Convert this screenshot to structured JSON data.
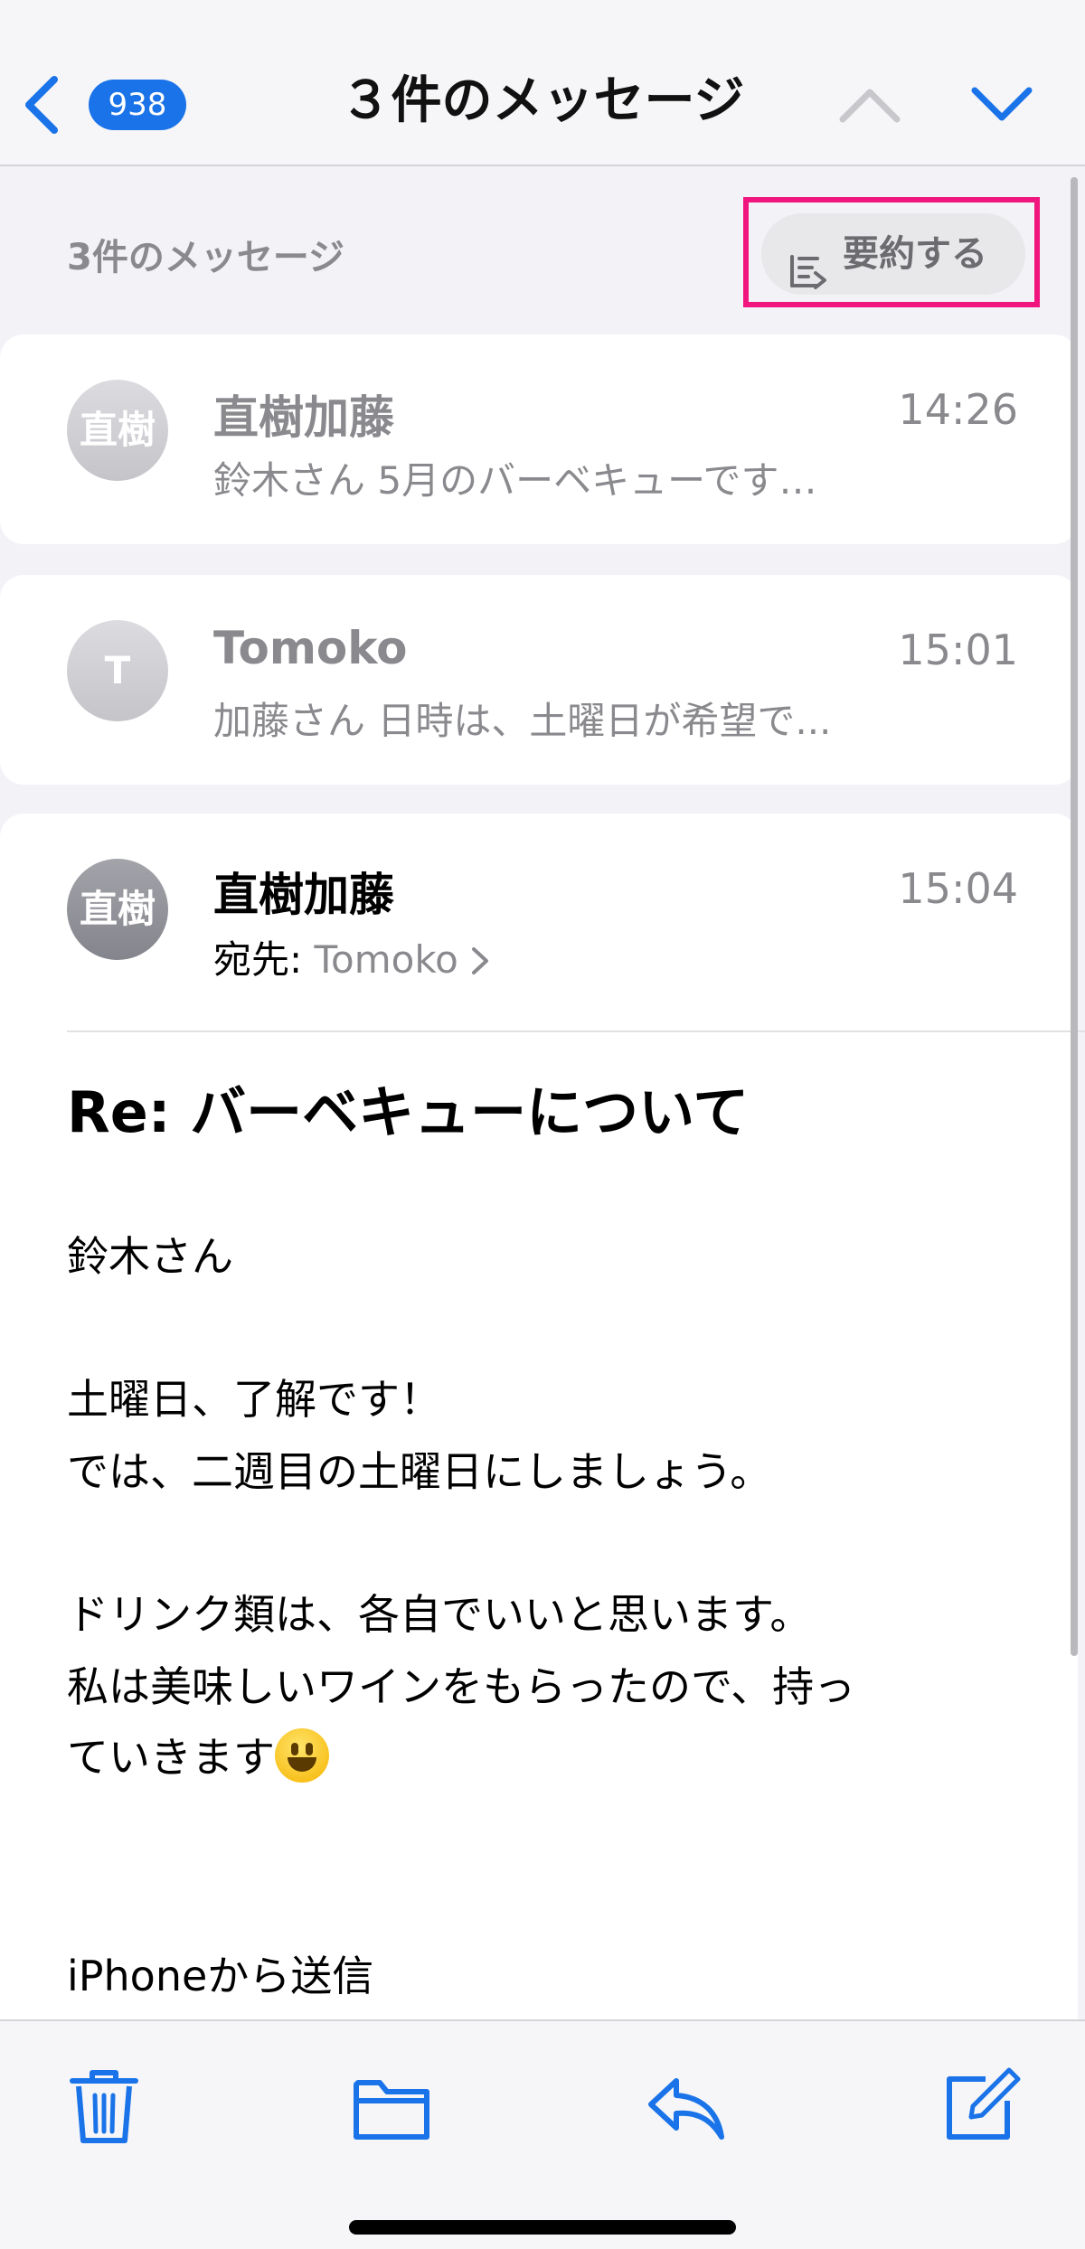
{
  "nav": {
    "unread_count": "938",
    "title": "３件のメッセージ"
  },
  "thread": {
    "count_label": "3件のメッセージ",
    "summarize_label": "要約する"
  },
  "messages": [
    {
      "avatar": "直樹",
      "sender": "直樹加藤",
      "time": "14:26",
      "preview": "鈴木さん 5月のバーベキューです…"
    },
    {
      "avatar": "T",
      "sender": "Tomoko",
      "time": "15:01",
      "preview": "加藤さん 日時は、土曜日が希望で..."
    }
  ],
  "open_message": {
    "avatar": "直樹",
    "sender": "直樹加藤",
    "time": "15:04",
    "to_label": "宛先:",
    "to_name": "Tomoko",
    "subject": "Re: バーベキューについて",
    "body": [
      "鈴木さん",
      "土曜日、了解です！",
      "では、二週目の土曜日にしましょう。",
      "ドリンク類は、各自でいいと思います。",
      "私は美味しいワインをもらったので、持っ",
      "ていきます",
      "iPhoneから送信"
    ]
  },
  "colors": {
    "accent": "#1a73e8",
    "highlight": "#f0167d",
    "secondary_text": "#8a8a8e"
  },
  "icons": [
    "back-chevron-icon",
    "chevron-up-icon",
    "chevron-down-icon",
    "summarize-icon",
    "reply-indicator-icon",
    "grinning-face-emoji",
    "trash-icon",
    "folder-icon",
    "reply-icon",
    "compose-icon"
  ]
}
